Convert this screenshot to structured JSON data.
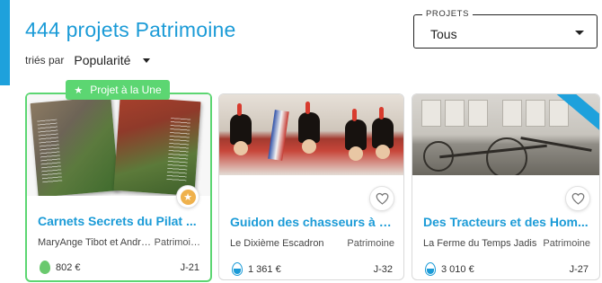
{
  "header": {
    "title": "444 projets Patrimoine",
    "sort_prefix": "triés par",
    "sort_value": "Popularité",
    "filter_legend": "PROJETS",
    "filter_value": "Tous"
  },
  "featured_badge": "Projet à la Une",
  "colors": {
    "accent_blue": "#1b9bd7",
    "featured_green": "#5cd672",
    "favorite_gold": "#efb14c"
  },
  "cards": [
    {
      "title": "Carnets Secrets du Pilat ...",
      "owner": "MaryAnge Tibot et André...",
      "category": "Patrimoine",
      "amount": "802 €",
      "days_left": "J-21",
      "featured": true,
      "progress_icon": "egg-green-icon",
      "favorite_icon": "star-icon"
    },
    {
      "title": "Guidon des chasseurs à c...",
      "owner": "Le Dixième Escadron",
      "category": "Patrimoine",
      "amount": "1 361 €",
      "days_left": "J-32",
      "featured": false,
      "progress_icon": "egg-blue-icon",
      "favorite_icon": "heart-icon"
    },
    {
      "title": "Des Tracteurs et des Hom...",
      "owner": "La Ferme du Temps Jadis",
      "category": "Patrimoine",
      "amount": "3 010 €",
      "days_left": "J-27",
      "featured": false,
      "progress_icon": "egg-blue-icon",
      "favorite_icon": "heart-icon"
    }
  ]
}
